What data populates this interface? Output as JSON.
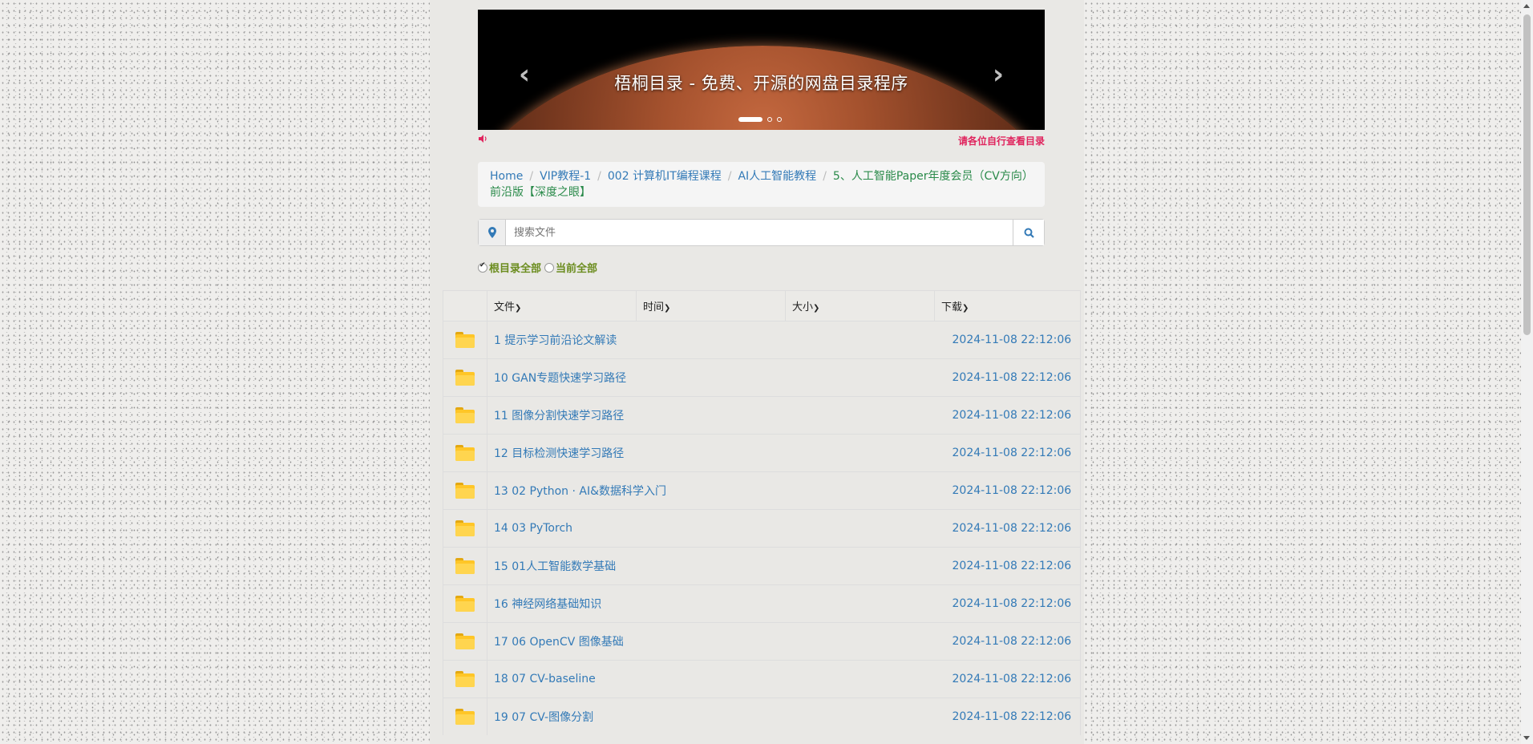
{
  "banner": {
    "title": "梧桐目录 - 免费、开源的网盘目录程序",
    "prev_icon": "chevron-left-icon",
    "next_icon": "chevron-right-icon",
    "slides": 3,
    "active_slide": 1
  },
  "notice": {
    "icon": "speaker-icon",
    "text": "请各位自行查看目录"
  },
  "breadcrumb": {
    "items": [
      {
        "label": "Home"
      },
      {
        "label": "VIP教程-1"
      },
      {
        "label": "002 计算机IT编程课程"
      },
      {
        "label": "AI人工智能教程"
      },
      {
        "label": "5、人工智能Paper年度会员（CV方向）前沿版【深度之眼】"
      }
    ]
  },
  "search": {
    "placeholder": "搜索文件",
    "pin_icon": "map-marker-icon",
    "button_icon": "search-icon"
  },
  "scopes": {
    "root_all": "根目录全部",
    "current_all": "当前全部",
    "selected": "root_all"
  },
  "table": {
    "headers": {
      "file": "文件",
      "time": "时间",
      "size": "大小",
      "download": "下载"
    },
    "rows": [
      {
        "name": "1 提示学习前沿论文解读",
        "date": "2024-11-08 22:12:06"
      },
      {
        "name": "10 GAN专题快速学习路径",
        "date": "2024-11-08 22:12:06"
      },
      {
        "name": "11 图像分割快速学习路径",
        "date": "2024-11-08 22:12:06"
      },
      {
        "name": "12 目标检测快速学习路径",
        "date": "2024-11-08 22:12:06"
      },
      {
        "name": "13 02 Python · AI&数据科学入门",
        "date": "2024-11-08 22:12:06"
      },
      {
        "name": "14 03 PyTorch",
        "date": "2024-11-08 22:12:06"
      },
      {
        "name": "15 01人工智能数学基础",
        "date": "2024-11-08 22:12:06"
      },
      {
        "name": "16 神经网络基础知识",
        "date": "2024-11-08 22:12:06"
      },
      {
        "name": "17 06 OpenCV 图像基础",
        "date": "2024-11-08 22:12:06"
      },
      {
        "name": "18 07 CV-baseline",
        "date": "2024-11-08 22:12:06"
      },
      {
        "name": "19 07 CV-图像分割",
        "date": "2024-11-08 22:12:06"
      }
    ]
  },
  "colors": {
    "link": "#337ab7",
    "notice": "#e0245e",
    "scope_label": "#6b8c1e",
    "folder": "#ffc627"
  }
}
